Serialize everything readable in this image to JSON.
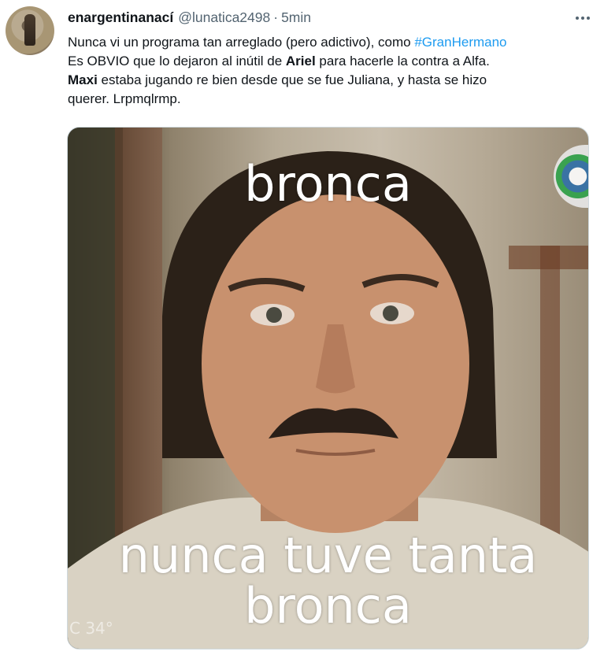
{
  "tweet": {
    "display_name": "enargentinanací",
    "handle": "@lunatica2498",
    "separator": "·",
    "time": "5min",
    "text": {
      "l1_pre": "Nunca vi un programa tan arreglado (pero adictivo), como ",
      "l1_hashtag": "#GranHermano",
      "l2_pre": "Es OBVIO que lo dejaron al inútil de ",
      "l2_bold": "Ariel",
      "l2_post": " para hacerle la contra a Alfa.",
      "l3_bold": "Maxi",
      "l3_post": " estaba jugando re bien desde que se fue Juliana, y hasta se hizo",
      "l4": "querer. Lrpmqlrmp."
    },
    "media": {
      "caption_top": "bronca",
      "caption_bottom_1": "nunca tuve tanta",
      "caption_bottom_2": "bronca",
      "watermark": "C 34°"
    }
  },
  "icons": {
    "more": "more-dots-icon",
    "avatar": "avatar"
  },
  "colors": {
    "link": "#1d9bf0",
    "secondary_text": "#536471",
    "primary_text": "#0f1419"
  }
}
